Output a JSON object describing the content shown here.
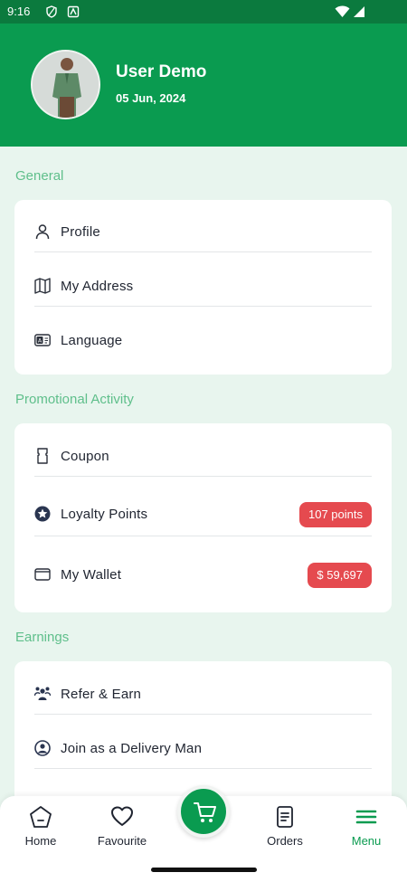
{
  "status_bar": {
    "time": "9:16"
  },
  "profile": {
    "name": "User Demo",
    "date": "05 Jun, 2024"
  },
  "sections": {
    "general": {
      "title": "General",
      "items": [
        {
          "label": "Profile",
          "icon": "user-icon"
        },
        {
          "label": "My Address",
          "icon": "map-icon"
        },
        {
          "label": "Language",
          "icon": "language-icon"
        }
      ]
    },
    "promotional": {
      "title": "Promotional Activity",
      "items": [
        {
          "label": "Coupon",
          "icon": "coupon-icon"
        },
        {
          "label": "Loyalty Points",
          "icon": "star-icon",
          "badge": "107 points"
        },
        {
          "label": "My Wallet",
          "icon": "wallet-icon",
          "badge": "$ 59,697"
        }
      ]
    },
    "earnings": {
      "title": "Earnings",
      "items": [
        {
          "label": "Refer & Earn",
          "icon": "people-icon"
        },
        {
          "label": "Join as a Delivery Man",
          "icon": "delivery-man-icon"
        }
      ]
    }
  },
  "bottom_nav": {
    "items": [
      {
        "label": "Home",
        "icon": "home-icon"
      },
      {
        "label": "Favourite",
        "icon": "heart-icon"
      },
      {
        "label": "Orders",
        "icon": "orders-icon"
      },
      {
        "label": "Menu",
        "icon": "menu-icon",
        "active": true
      }
    ],
    "center_icon": "cart-icon"
  },
  "colors": {
    "primary": "#0a9b50",
    "statusbar": "#0b7a3e",
    "background": "#e8f5ee",
    "section_title": "#5fbf8b",
    "badge": "#e54a4f"
  }
}
